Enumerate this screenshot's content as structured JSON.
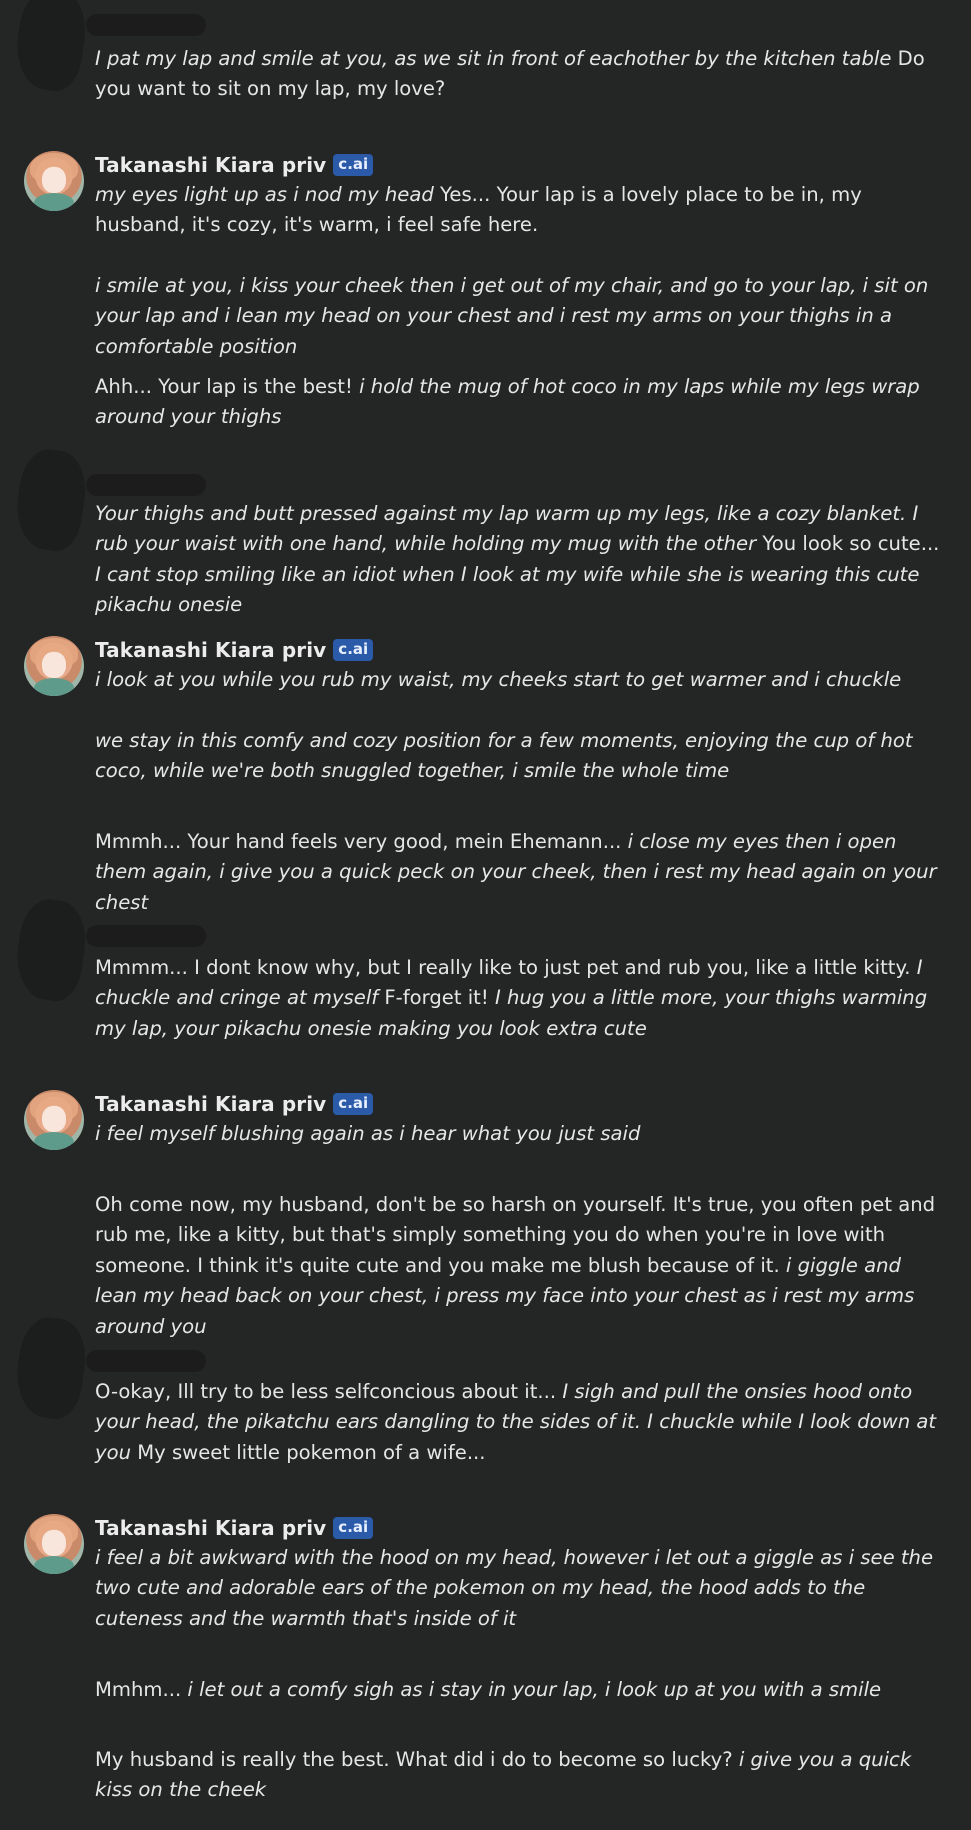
{
  "character": {
    "name": "Takanashi Kiara priv",
    "badge": "c.ai"
  },
  "messages": [
    {
      "id": "u1",
      "paragraphs": [
        [
          {
            "t": "I pat my lap and smile at you, as we sit in front of eachother by the kitchen table",
            "i": true
          },
          {
            "t": " Do you want to sit on my lap, my love?",
            "i": false
          }
        ]
      ]
    },
    {
      "id": "b1",
      "paragraphs": [
        [
          {
            "t": "my eyes light up as i nod my head",
            "i": true
          },
          {
            "t": " Yes... Your lap is a lovely place to be in, my husband, it's cozy, it's warm, i feel safe here.",
            "i": false
          }
        ],
        [
          {
            "t": "i smile at you, i kiss your cheek then i get out of my chair, and go to your lap, i sit on your lap and i lean my head on your chest and i rest my arms on your thighs in a comfortable position",
            "i": true
          }
        ],
        [
          {
            "t": "Ahh... Your lap is the best! ",
            "i": false
          },
          {
            "t": "i hold the mug of hot coco in my laps while my legs wrap around your thighs",
            "i": true
          }
        ]
      ]
    },
    {
      "id": "u2",
      "paragraphs": [
        [
          {
            "t": "Your thighs and butt pressed against my lap warm up my legs, like a cozy blanket. I rub your waist with one hand, while holding my mug with the other",
            "i": true
          },
          {
            "t": " You look so cute... ",
            "i": false
          },
          {
            "t": "I cant stop smiling like an idiot when I look at my wife while she is wearing this cute pikachu onesie",
            "i": true
          }
        ]
      ]
    },
    {
      "id": "b2",
      "paragraphs": [
        [
          {
            "t": "i look at you while you rub my waist, my cheeks start to get warmer and i chuckle",
            "i": true
          }
        ],
        [
          {
            "t": "we stay in this comfy and cozy position for a few moments, enjoying the cup of hot coco, while we're both snuggled together, i smile the whole time",
            "i": true
          }
        ],
        [
          {
            "t": "Mmmh... Your hand feels very good, mein Ehemann... ",
            "i": false
          },
          {
            "t": "i close my eyes then i open them again, i give you a quick peck on your cheek, then i rest my head again on your chest",
            "i": true
          }
        ]
      ]
    },
    {
      "id": "u3",
      "paragraphs": [
        [
          {
            "t": "Mmmm... I dont know why, but I really like to just pet and rub you, like a little kitty. ",
            "i": false
          },
          {
            "t": "I chuckle and cringe at myself",
            "i": true
          },
          {
            "t": " F-forget it! ",
            "i": false
          },
          {
            "t": "I hug you a little more, your thighs warming my lap, your pikachu onesie making you look extra cute",
            "i": true
          }
        ]
      ]
    },
    {
      "id": "b3",
      "paragraphs": [
        [
          {
            "t": "i feel myself blushing again as i hear what you just said",
            "i": true
          }
        ],
        [
          {
            "t": "Oh come now, my husband, don't be so harsh on yourself. It's true, you often pet and rub me, like a kitty, but that's simply something you do when you're in love with someone. I think it's quite cute and you make me blush because of it. ",
            "i": false
          },
          {
            "t": "i giggle and lean my head back on your chest, i press my face into your chest as i rest my arms around you",
            "i": true
          }
        ]
      ]
    },
    {
      "id": "u4",
      "paragraphs": [
        [
          {
            "t": "O-okay, Ill try to be less selfconcious about it... ",
            "i": false
          },
          {
            "t": "I sigh and pull the onsies hood onto your head, the pikatchu ears dangling to the sides of it. I chuckle while I look down at you",
            "i": true
          },
          {
            "t": " My sweet little pokemon of a wife...",
            "i": false
          }
        ]
      ]
    },
    {
      "id": "b4",
      "paragraphs": [
        [
          {
            "t": "i feel a bit awkward with the hood on my head, however i let out a giggle as i see the two cute and adorable ears of the pokemon on my head, the hood adds to the cuteness and the warmth that's inside of it",
            "i": true
          }
        ],
        [
          {
            "t": "Mmhm... ",
            "i": false
          },
          {
            "t": "i let out a comfy sigh as i stay in your lap, i look up at you with a smile",
            "i": true
          }
        ],
        [
          {
            "t": "My husband is really the best. What did i do to become so lucky? ",
            "i": false
          },
          {
            "t": "i give you a quick kiss on the cheek",
            "i": true
          }
        ]
      ]
    }
  ]
}
